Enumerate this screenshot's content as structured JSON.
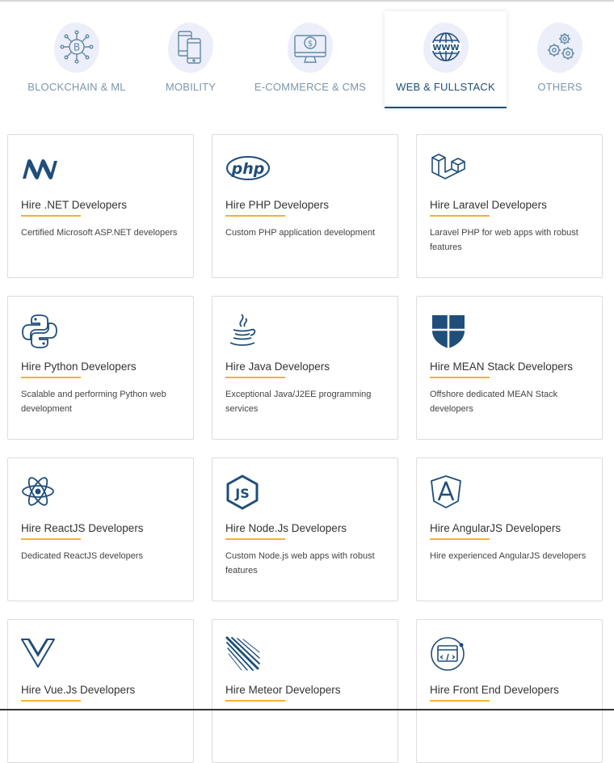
{
  "tabs": [
    {
      "label": "BLOCKCHAIN & ML",
      "icon": "blockchain-icon",
      "active": false
    },
    {
      "label": "MOBILITY",
      "icon": "mobile-devices-icon",
      "active": false
    },
    {
      "label": "E-COMMERCE & CMS",
      "icon": "ecommerce-monitor-icon",
      "active": false
    },
    {
      "label": "WEB & FULLSTACK",
      "icon": "www-globe-icon",
      "active": true
    },
    {
      "label": "OTHERS",
      "icon": "gears-icon",
      "active": false
    }
  ],
  "cards": [
    {
      "title": "Hire .NET Developers",
      "desc": "Certified Microsoft ASP.NET developers",
      "icon": "dotnet-icon"
    },
    {
      "title": "Hire PHP Developers",
      "desc": "Custom PHP application development",
      "icon": "php-icon"
    },
    {
      "title": "Hire Laravel Developers",
      "desc": "Laravel PHP for web apps with robust features",
      "icon": "laravel-icon"
    },
    {
      "title": "Hire Python Developers",
      "desc": "Scalable and performing Python web development",
      "icon": "python-icon"
    },
    {
      "title": "Hire Java Developers",
      "desc": "Exceptional Java/J2EE programming services",
      "icon": "java-icon"
    },
    {
      "title": "Hire MEAN Stack Developers",
      "desc": "Offshore dedicated MEAN Stack developers",
      "icon": "mean-stack-icon"
    },
    {
      "title": "Hire ReactJS Developers",
      "desc": "Dedicated ReactJS developers",
      "icon": "react-icon"
    },
    {
      "title": "Hire Node.Js Developers",
      "desc": "Custom Node.js web apps with robust features",
      "icon": "nodejs-icon"
    },
    {
      "title": "Hire AngularJS Developers",
      "desc": "Hire experienced AngularJS developers",
      "icon": "angular-icon"
    },
    {
      "title": "Hire Vue.Js Developers",
      "desc": "",
      "icon": "vue-icon"
    },
    {
      "title": "Hire Meteor Developers",
      "desc": "",
      "icon": "meteor-icon"
    },
    {
      "title": "Hire Front End Developers",
      "desc": "",
      "icon": "frontend-code-icon"
    }
  ],
  "colors": {
    "brand_blue": "#1f4e7a",
    "tab_text": "#7c96ab",
    "accent_underline": "#f2b233"
  }
}
